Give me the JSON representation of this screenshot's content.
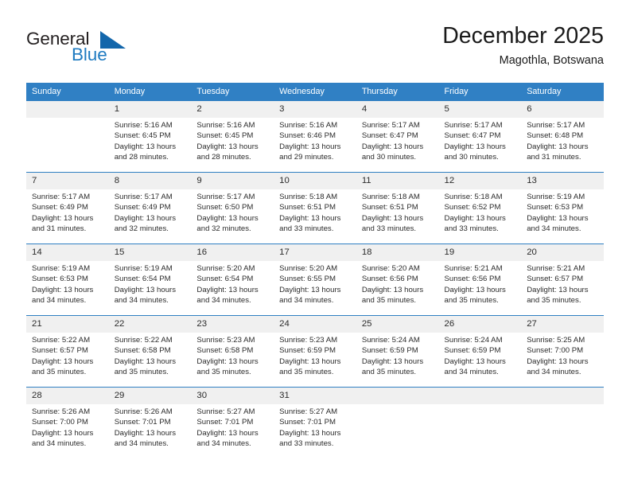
{
  "brand": {
    "name_part1": "General",
    "name_part2": "Blue",
    "triangle_color": "#1266ab",
    "blue_color": "#1f7bc1"
  },
  "header": {
    "title": "December 2025",
    "subtitle": "Magothla, Botswana",
    "header_bg": "#3080c4",
    "row_border": "#2f7fc2",
    "daynum_bg": "#f0f0f0"
  },
  "weekdays": [
    "Sunday",
    "Monday",
    "Tuesday",
    "Wednesday",
    "Thursday",
    "Friday",
    "Saturday"
  ],
  "weeks": [
    [
      {
        "day": "",
        "sunrise": "",
        "sunset": "",
        "daylight1": "",
        "daylight2": "",
        "empty": true
      },
      {
        "day": "1",
        "sunrise": "Sunrise: 5:16 AM",
        "sunset": "Sunset: 6:45 PM",
        "daylight1": "Daylight: 13 hours",
        "daylight2": "and 28 minutes."
      },
      {
        "day": "2",
        "sunrise": "Sunrise: 5:16 AM",
        "sunset": "Sunset: 6:45 PM",
        "daylight1": "Daylight: 13 hours",
        "daylight2": "and 28 minutes."
      },
      {
        "day": "3",
        "sunrise": "Sunrise: 5:16 AM",
        "sunset": "Sunset: 6:46 PM",
        "daylight1": "Daylight: 13 hours",
        "daylight2": "and 29 minutes."
      },
      {
        "day": "4",
        "sunrise": "Sunrise: 5:17 AM",
        "sunset": "Sunset: 6:47 PM",
        "daylight1": "Daylight: 13 hours",
        "daylight2": "and 30 minutes."
      },
      {
        "day": "5",
        "sunrise": "Sunrise: 5:17 AM",
        "sunset": "Sunset: 6:47 PM",
        "daylight1": "Daylight: 13 hours",
        "daylight2": "and 30 minutes."
      },
      {
        "day": "6",
        "sunrise": "Sunrise: 5:17 AM",
        "sunset": "Sunset: 6:48 PM",
        "daylight1": "Daylight: 13 hours",
        "daylight2": "and 31 minutes."
      }
    ],
    [
      {
        "day": "7",
        "sunrise": "Sunrise: 5:17 AM",
        "sunset": "Sunset: 6:49 PM",
        "daylight1": "Daylight: 13 hours",
        "daylight2": "and 31 minutes."
      },
      {
        "day": "8",
        "sunrise": "Sunrise: 5:17 AM",
        "sunset": "Sunset: 6:49 PM",
        "daylight1": "Daylight: 13 hours",
        "daylight2": "and 32 minutes."
      },
      {
        "day": "9",
        "sunrise": "Sunrise: 5:17 AM",
        "sunset": "Sunset: 6:50 PM",
        "daylight1": "Daylight: 13 hours",
        "daylight2": "and 32 minutes."
      },
      {
        "day": "10",
        "sunrise": "Sunrise: 5:18 AM",
        "sunset": "Sunset: 6:51 PM",
        "daylight1": "Daylight: 13 hours",
        "daylight2": "and 33 minutes."
      },
      {
        "day": "11",
        "sunrise": "Sunrise: 5:18 AM",
        "sunset": "Sunset: 6:51 PM",
        "daylight1": "Daylight: 13 hours",
        "daylight2": "and 33 minutes."
      },
      {
        "day": "12",
        "sunrise": "Sunrise: 5:18 AM",
        "sunset": "Sunset: 6:52 PM",
        "daylight1": "Daylight: 13 hours",
        "daylight2": "and 33 minutes."
      },
      {
        "day": "13",
        "sunrise": "Sunrise: 5:19 AM",
        "sunset": "Sunset: 6:53 PM",
        "daylight1": "Daylight: 13 hours",
        "daylight2": "and 34 minutes."
      }
    ],
    [
      {
        "day": "14",
        "sunrise": "Sunrise: 5:19 AM",
        "sunset": "Sunset: 6:53 PM",
        "daylight1": "Daylight: 13 hours",
        "daylight2": "and 34 minutes."
      },
      {
        "day": "15",
        "sunrise": "Sunrise: 5:19 AM",
        "sunset": "Sunset: 6:54 PM",
        "daylight1": "Daylight: 13 hours",
        "daylight2": "and 34 minutes."
      },
      {
        "day": "16",
        "sunrise": "Sunrise: 5:20 AM",
        "sunset": "Sunset: 6:54 PM",
        "daylight1": "Daylight: 13 hours",
        "daylight2": "and 34 minutes."
      },
      {
        "day": "17",
        "sunrise": "Sunrise: 5:20 AM",
        "sunset": "Sunset: 6:55 PM",
        "daylight1": "Daylight: 13 hours",
        "daylight2": "and 34 minutes."
      },
      {
        "day": "18",
        "sunrise": "Sunrise: 5:20 AM",
        "sunset": "Sunset: 6:56 PM",
        "daylight1": "Daylight: 13 hours",
        "daylight2": "and 35 minutes."
      },
      {
        "day": "19",
        "sunrise": "Sunrise: 5:21 AM",
        "sunset": "Sunset: 6:56 PM",
        "daylight1": "Daylight: 13 hours",
        "daylight2": "and 35 minutes."
      },
      {
        "day": "20",
        "sunrise": "Sunrise: 5:21 AM",
        "sunset": "Sunset: 6:57 PM",
        "daylight1": "Daylight: 13 hours",
        "daylight2": "and 35 minutes."
      }
    ],
    [
      {
        "day": "21",
        "sunrise": "Sunrise: 5:22 AM",
        "sunset": "Sunset: 6:57 PM",
        "daylight1": "Daylight: 13 hours",
        "daylight2": "and 35 minutes."
      },
      {
        "day": "22",
        "sunrise": "Sunrise: 5:22 AM",
        "sunset": "Sunset: 6:58 PM",
        "daylight1": "Daylight: 13 hours",
        "daylight2": "and 35 minutes."
      },
      {
        "day": "23",
        "sunrise": "Sunrise: 5:23 AM",
        "sunset": "Sunset: 6:58 PM",
        "daylight1": "Daylight: 13 hours",
        "daylight2": "and 35 minutes."
      },
      {
        "day": "24",
        "sunrise": "Sunrise: 5:23 AM",
        "sunset": "Sunset: 6:59 PM",
        "daylight1": "Daylight: 13 hours",
        "daylight2": "and 35 minutes."
      },
      {
        "day": "25",
        "sunrise": "Sunrise: 5:24 AM",
        "sunset": "Sunset: 6:59 PM",
        "daylight1": "Daylight: 13 hours",
        "daylight2": "and 35 minutes."
      },
      {
        "day": "26",
        "sunrise": "Sunrise: 5:24 AM",
        "sunset": "Sunset: 6:59 PM",
        "daylight1": "Daylight: 13 hours",
        "daylight2": "and 34 minutes."
      },
      {
        "day": "27",
        "sunrise": "Sunrise: 5:25 AM",
        "sunset": "Sunset: 7:00 PM",
        "daylight1": "Daylight: 13 hours",
        "daylight2": "and 34 minutes."
      }
    ],
    [
      {
        "day": "28",
        "sunrise": "Sunrise: 5:26 AM",
        "sunset": "Sunset: 7:00 PM",
        "daylight1": "Daylight: 13 hours",
        "daylight2": "and 34 minutes."
      },
      {
        "day": "29",
        "sunrise": "Sunrise: 5:26 AM",
        "sunset": "Sunset: 7:01 PM",
        "daylight1": "Daylight: 13 hours",
        "daylight2": "and 34 minutes."
      },
      {
        "day": "30",
        "sunrise": "Sunrise: 5:27 AM",
        "sunset": "Sunset: 7:01 PM",
        "daylight1": "Daylight: 13 hours",
        "daylight2": "and 34 minutes."
      },
      {
        "day": "31",
        "sunrise": "Sunrise: 5:27 AM",
        "sunset": "Sunset: 7:01 PM",
        "daylight1": "Daylight: 13 hours",
        "daylight2": "and 33 minutes."
      },
      {
        "day": "",
        "sunrise": "",
        "sunset": "",
        "daylight1": "",
        "daylight2": "",
        "empty": true
      },
      {
        "day": "",
        "sunrise": "",
        "sunset": "",
        "daylight1": "",
        "daylight2": "",
        "empty": true
      },
      {
        "day": "",
        "sunrise": "",
        "sunset": "",
        "daylight1": "",
        "daylight2": "",
        "empty": true
      }
    ]
  ]
}
